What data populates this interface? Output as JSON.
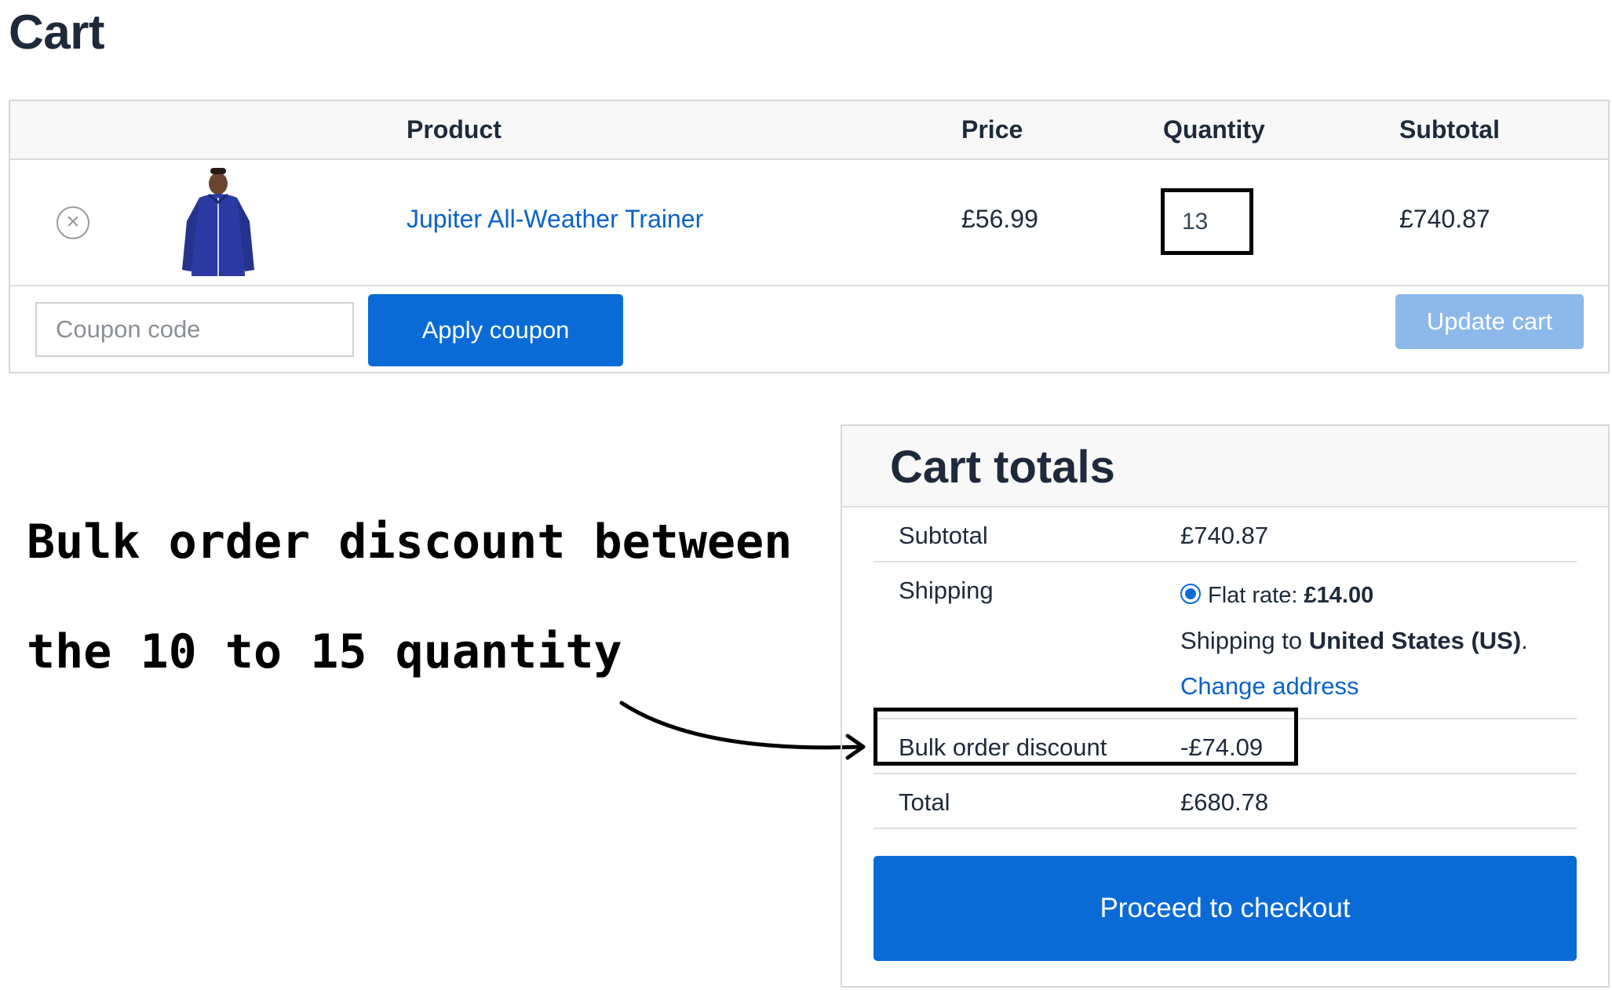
{
  "page": {
    "title": "Cart"
  },
  "cart_table": {
    "headers": {
      "product": "Product",
      "price": "Price",
      "quantity": "Quantity",
      "subtotal": "Subtotal"
    },
    "items": [
      {
        "remove_icon": "remove-circle-x-icon",
        "image": "blue-jacket-product-image",
        "name": "Jupiter All-Weather Trainer",
        "price": "£56.99",
        "quantity": "13",
        "subtotal": "£740.87"
      }
    ],
    "remove_glyph": "×"
  },
  "coupon": {
    "placeholder": "Coupon code",
    "apply_label": "Apply coupon"
  },
  "update_label": "Update cart",
  "annotation": {
    "line1": "Bulk order discount between",
    "line2": "the 10 to 15 quantity"
  },
  "totals": {
    "title": "Cart totals",
    "subtotal_label": "Subtotal",
    "subtotal_value": "£740.87",
    "shipping_label": "Shipping",
    "shipping_option_prefix": "Flat rate: ",
    "shipping_option_price": "£14.00",
    "shipping_to_prefix": "Shipping to ",
    "shipping_to_country": "United States (US)",
    "shipping_to_suffix": ".",
    "change_address": "Change address",
    "discount_label": "Bulk order discount",
    "discount_value": "-£74.09",
    "total_label": "Total",
    "total_value": "£680.78",
    "checkout_label": "Proceed to checkout"
  },
  "colors": {
    "primary": "#0a6bd6",
    "link": "#0a63c7",
    "disabled_button": "#8db9ea",
    "text": "#1e2a3b",
    "highlight_border": "#000000"
  }
}
